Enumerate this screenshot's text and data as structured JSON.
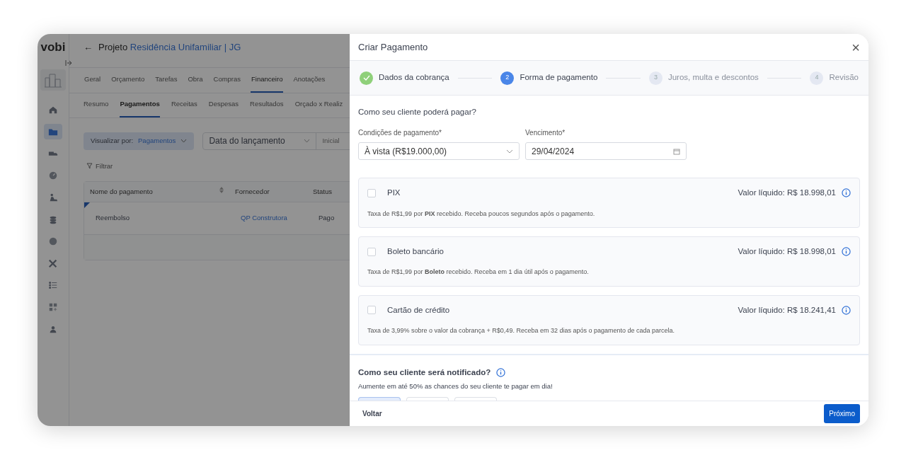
{
  "app": {
    "logo": "vobi",
    "back_icon": "←",
    "title_prefix": "Projeto",
    "project_name": "Residência Unifamiliar | JG",
    "sidebar_items": [
      {
        "kind": "home",
        "selected": false
      },
      {
        "kind": "folder",
        "selected": true
      },
      {
        "kind": "truck",
        "selected": false
      },
      {
        "kind": "gauge",
        "selected": false
      },
      {
        "kind": "worker",
        "selected": false
      },
      {
        "kind": "coins",
        "selected": false
      },
      {
        "kind": "dollar",
        "selected": false
      },
      {
        "kind": "tools",
        "selected": false
      },
      {
        "kind": "list",
        "selected": false
      },
      {
        "kind": "grid",
        "selected": false
      },
      {
        "kind": "people",
        "selected": false
      }
    ],
    "tabs": [
      {
        "label": "Geral",
        "selected": false
      },
      {
        "label": "Orçamento",
        "selected": false
      },
      {
        "label": "Tarefas",
        "selected": false
      },
      {
        "label": "Obra",
        "selected": false
      },
      {
        "label": "Compras",
        "selected": false
      },
      {
        "label": "Financeiro",
        "selected": true
      },
      {
        "label": "Anotações",
        "selected": false
      }
    ],
    "subtabs": [
      {
        "label": "Resumo",
        "selected": false
      },
      {
        "label": "Pagamentos",
        "selected": true
      },
      {
        "label": "Receitas",
        "selected": false
      },
      {
        "label": "Despesas",
        "selected": false
      },
      {
        "label": "Resultados",
        "selected": false
      },
      {
        "label": "Orçado x Realiz",
        "selected": false
      }
    ],
    "view_by": {
      "label": "Visualizar por:",
      "value": "Pagamentos"
    },
    "date_filter": {
      "value": "Data do lançamento",
      "placeholder": "Inicial"
    },
    "filter_label": "Filtrar",
    "table": {
      "columns": [
        "Nome do pagamento",
        "Fornecedor",
        "Status"
      ],
      "rows": [
        {
          "name": "Reembolso",
          "supplier": "QP Construtora",
          "status": "Pago"
        }
      ]
    }
  },
  "drawer": {
    "title": "Criar Pagamento",
    "close": "×",
    "steps": [
      {
        "label": "Dados da cobrança",
        "done": true,
        "selected": false
      },
      {
        "number": "2",
        "label": "Forma de pagamento",
        "done": false,
        "selected": true
      },
      {
        "number": "3",
        "label": "Juros, multa e descontos",
        "done": false,
        "selected": false
      },
      {
        "number": "4",
        "label": "Revisão",
        "done": false,
        "selected": false
      }
    ],
    "question": "Como seu cliente poderá pagar?",
    "conditions": {
      "label": "Condições de pagamento*",
      "value": "À vista (R$19.000,00)"
    },
    "due_date": {
      "label": "Vencimento*",
      "value": "29/04/2024"
    },
    "methods": [
      {
        "name": "PIX",
        "checked": false,
        "net_value": "Valor líquido: R$ 18.998,01",
        "description": "Taxa de R$1,99 por **PIX** recebido. Receba poucos segundos após o pagamento."
      },
      {
        "name": "Boleto bancário",
        "checked": false,
        "net_value": "Valor líquido: R$ 18.998,01",
        "description": "Taxa de R$1,99 por **Boleto** recebido. Receba em 1 dia útil após o pagamento."
      },
      {
        "name": "Cartão de crédito",
        "checked": false,
        "net_value": "Valor líquido: R$ 18.241,41",
        "description": "Taxa de 3,99% sobre o valor da cobrança + R$0,49. Receba em 32 dias após o pagamento de cada parcela."
      }
    ],
    "notify_title": "Como seu cliente será notificado?",
    "notify_subtitle": "Aumente em até 50% as chances do seu cliente te pagar em dia!",
    "notify_options": [
      {
        "selected": true
      },
      {
        "selected": false
      },
      {
        "selected": false
      }
    ],
    "back_button": "Voltar",
    "next_button": "Próximo"
  }
}
